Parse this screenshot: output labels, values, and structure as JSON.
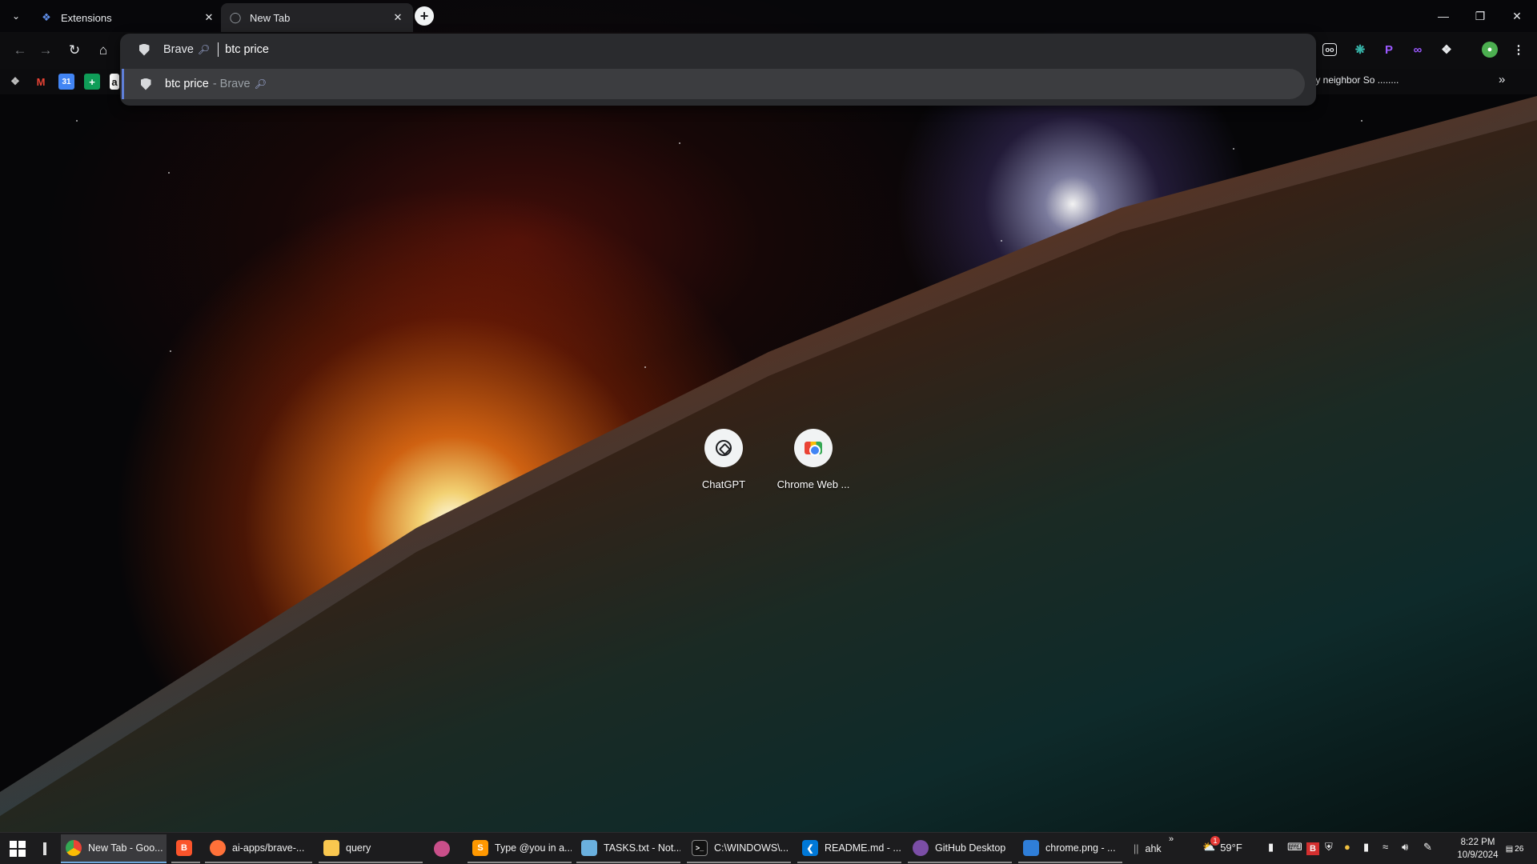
{
  "browser": {
    "tabs": [
      {
        "title": "Extensions",
        "icon": "puzzle-icon",
        "active": false
      },
      {
        "title": "New Tab",
        "icon": "globe-icon",
        "active": true
      }
    ]
  },
  "omnibox": {
    "keyword": "Brave",
    "query": "btc price",
    "suggestion_query": "btc price",
    "suggestion_engine": "- Brave"
  },
  "bookmarks": {
    "overflow_text": "ty neighbor So ........"
  },
  "shortcuts": [
    {
      "label": "ChatGPT"
    },
    {
      "label": "Chrome Web ..."
    }
  ],
  "taskbar": {
    "apps": [
      {
        "label": "New Tab - Goo...",
        "icon": "chrome-icon"
      },
      {
        "label": "",
        "icon": "brave-icon"
      },
      {
        "label": "ai-apps/brave-...",
        "icon": "firefox-icon"
      },
      {
        "label": "query",
        "icon": "folder-icon"
      },
      {
        "label": "",
        "icon": "snipping-tool-icon"
      },
      {
        "label": "Type @you in a...",
        "icon": "sublime-icon"
      },
      {
        "label": "TASKS.txt - Not...",
        "icon": "notepad-icon"
      },
      {
        "label": "C:\\WINDOWS\\...",
        "icon": "terminal-icon"
      },
      {
        "label": "README.md - ...",
        "icon": "vscode-icon"
      },
      {
        "label": "GitHub Desktop",
        "icon": "github-desktop-icon"
      },
      {
        "label": "chrome.png - ...",
        "icon": "photos-icon"
      },
      {
        "label": "ahk",
        "icon": "ahk-icon"
      }
    ],
    "weather_temp": "59°F",
    "weather_badge": "1",
    "time": "8:22 PM",
    "date": "10/9/2024",
    "notification_count": "26"
  },
  "colors": {
    "omnibox_bg": "#2a2b2e",
    "suggestion_highlight": "#3c3d40",
    "accent": "#5f7fd8",
    "taskbar_bg": "#1c1c1e"
  }
}
